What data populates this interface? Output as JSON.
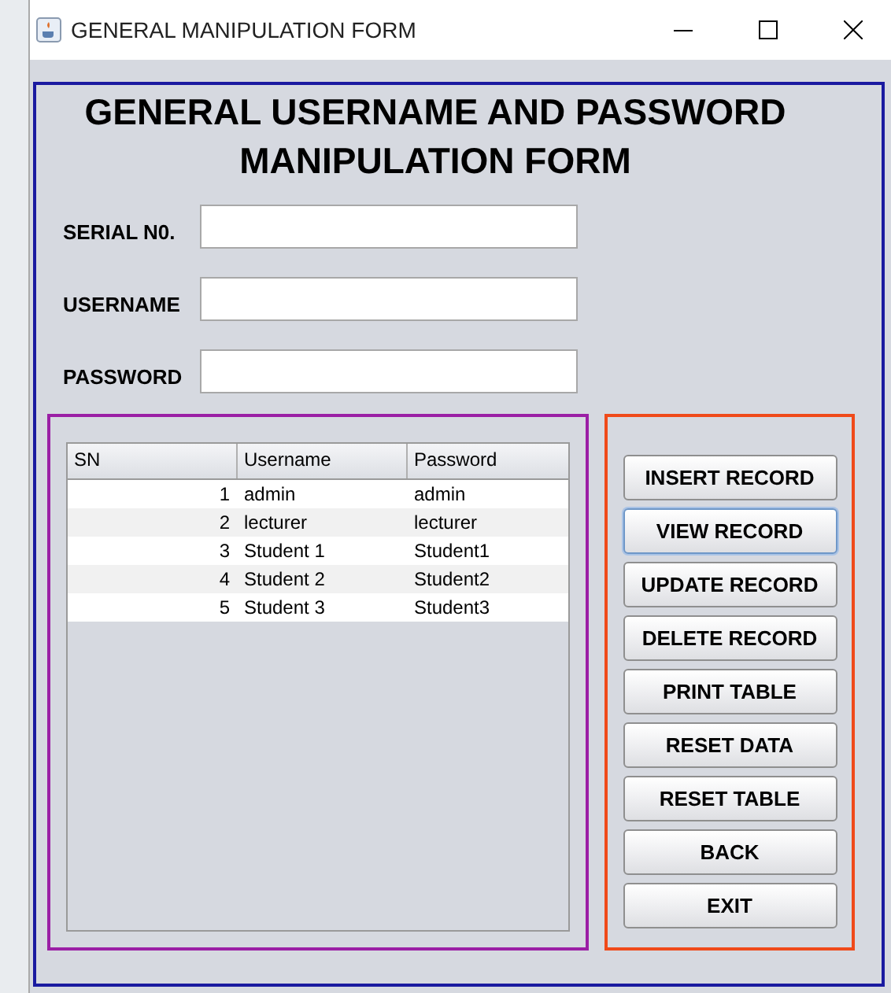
{
  "window": {
    "title": "GENERAL MANIPULATION FORM"
  },
  "heading": [
    "GENERAL USERNAME AND PASSWORD",
    "MANIPULATION FORM"
  ],
  "fields": [
    {
      "label": "SERIAL N0."
    },
    {
      "label": "USERNAME"
    },
    {
      "label": "PASSWORD"
    }
  ],
  "table": {
    "columns": [
      "SN",
      "Username",
      "Password"
    ],
    "rows": [
      [
        "1",
        "admin",
        "admin"
      ],
      [
        "2",
        "lecturer",
        "lecturer"
      ],
      [
        "3",
        "Student 1",
        "Student1"
      ],
      [
        "4",
        "Student 2",
        "Student2"
      ],
      [
        "5",
        "Student 3",
        "Student3"
      ]
    ]
  },
  "buttons": [
    {
      "label": "INSERT RECORD",
      "focused": false
    },
    {
      "label": "VIEW RECORD",
      "focused": true
    },
    {
      "label": "UPDATE RECORD",
      "focused": false
    },
    {
      "label": "DELETE RECORD",
      "focused": false
    },
    {
      "label": "PRINT TABLE",
      "focused": false
    },
    {
      "label": "RESET DATA",
      "focused": false
    },
    {
      "label": "RESET TABLE",
      "focused": false
    },
    {
      "label": "BACK",
      "focused": false
    },
    {
      "label": "EXIT",
      "focused": false
    }
  ]
}
